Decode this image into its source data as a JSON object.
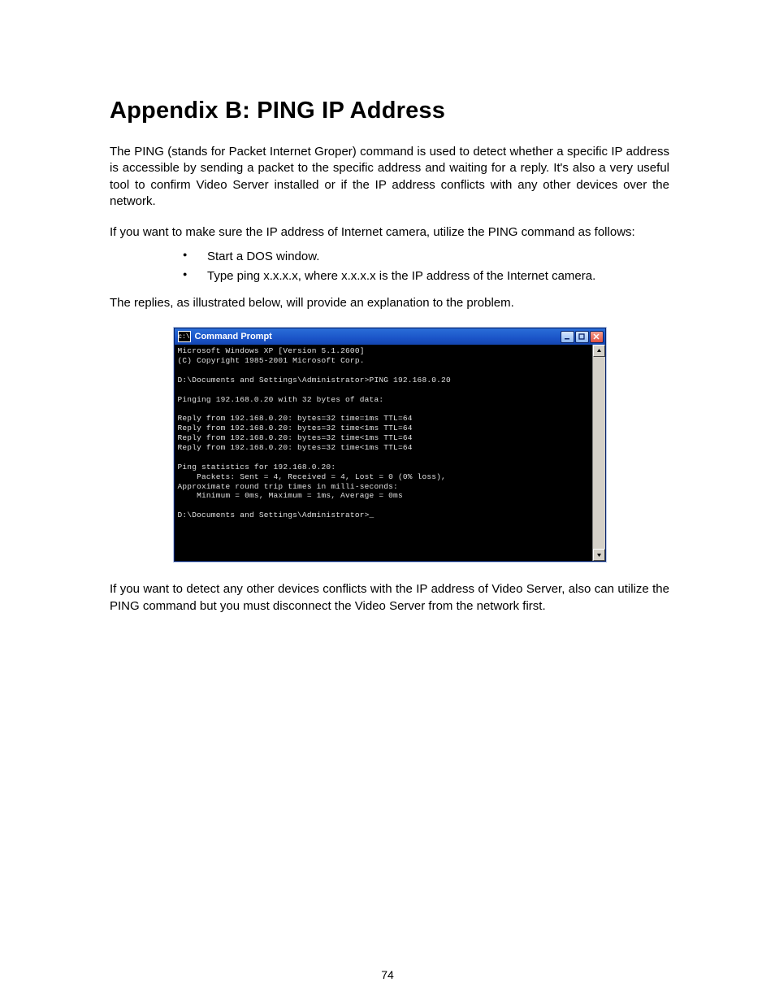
{
  "heading": "Appendix B: PING IP Address",
  "para1": "The PING (stands for Packet Internet Groper) command is used to detect whether a specific IP address is accessible by sending a packet to the specific address and waiting for a reply. It's also a very useful tool to confirm Video Server installed or if the IP address conflicts with any other devices over the network.",
  "para2": "If you want to make sure the IP address of Internet camera, utilize the PING command as follows:",
  "bullets": [
    "Start a DOS window.",
    "Type ping x.x.x.x, where x.x.x.x is the IP address of the Internet camera."
  ],
  "para3": "The replies, as illustrated below, will provide an explanation to the problem.",
  "cmd": {
    "title": "Command Prompt",
    "lines": "Microsoft Windows XP [Version 5.1.2600]\n(C) Copyright 1985-2001 Microsoft Corp.\n\nD:\\Documents and Settings\\Administrator>PING 192.168.0.20\n\nPinging 192.168.0.20 with 32 bytes of data:\n\nReply from 192.168.0.20: bytes=32 time=1ms TTL=64\nReply from 192.168.0.20: bytes=32 time<1ms TTL=64\nReply from 192.168.0.20: bytes=32 time<1ms TTL=64\nReply from 192.168.0.20: bytes=32 time<1ms TTL=64\n\nPing statistics for 192.168.0.20:\n    Packets: Sent = 4, Received = 4, Lost = 0 (0% loss),\nApproximate round trip times in milli-seconds:\n    Minimum = 0ms, Maximum = 1ms, Average = 0ms\n\nD:\\Documents and Settings\\Administrator>_"
  },
  "para4": "If you want to detect any other devices conflicts with the IP address of Video Server, also can utilize the PING command but you must disconnect the Video Server from the network first.",
  "pageNumber": "74"
}
